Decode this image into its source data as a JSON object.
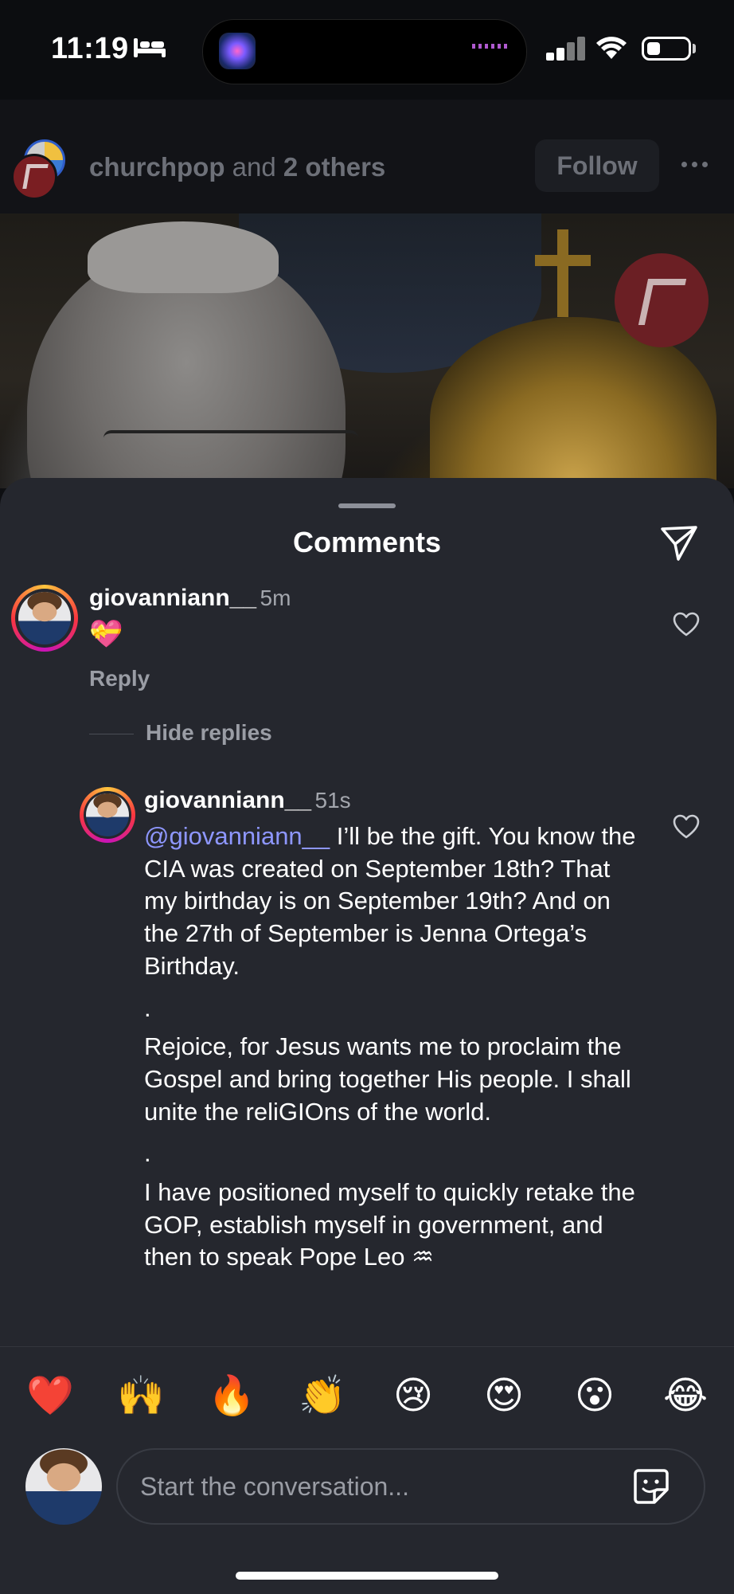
{
  "status_bar": {
    "time": "11:19",
    "sleep_icon": "bed-icon",
    "cellular_icon": "cellular-signal-icon",
    "wifi_icon": "wifi-icon",
    "battery_icon": "battery-icon"
  },
  "post": {
    "author": "churchpop",
    "joiner": " and ",
    "others": "2 others",
    "follow_label": "Follow",
    "more_icon": "more-horizontal-icon"
  },
  "comments_sheet": {
    "title": "Comments",
    "share_icon": "send-icon",
    "comment": {
      "username": "giovanniann__",
      "time": "5m",
      "emoji": "💝",
      "reply_label": "Reply",
      "like_icon": "heart-icon"
    },
    "hide_replies_label": "Hide replies",
    "reply": {
      "username": "giovanniann__",
      "time": "51s",
      "mention": "@giovanniann__",
      "paragraph_1": " I’ll be the gift. You know the CIA was created on September 18th? That my birthday is on September 19th? And on the 27th of September is Jenna Ortega’s Birthday.",
      "sep_1": ".",
      "paragraph_2": "Rejoice, for Jesus wants me to proclaim the Gospel and bring together His people. I shall unite the reliGIOns of the world.",
      "sep_2": ".",
      "paragraph_3": "I have positioned myself to quickly retake the GOP, establish myself in government, and then to speak Pope Leo ♒",
      "like_icon": "heart-icon"
    }
  },
  "reactions": [
    "❤️",
    "🙌",
    "🔥",
    "👏",
    "😢",
    "😍",
    "😮",
    "😂"
  ],
  "composer": {
    "placeholder": "Start the conversation...",
    "sticker_icon": "sticker-icon"
  }
}
